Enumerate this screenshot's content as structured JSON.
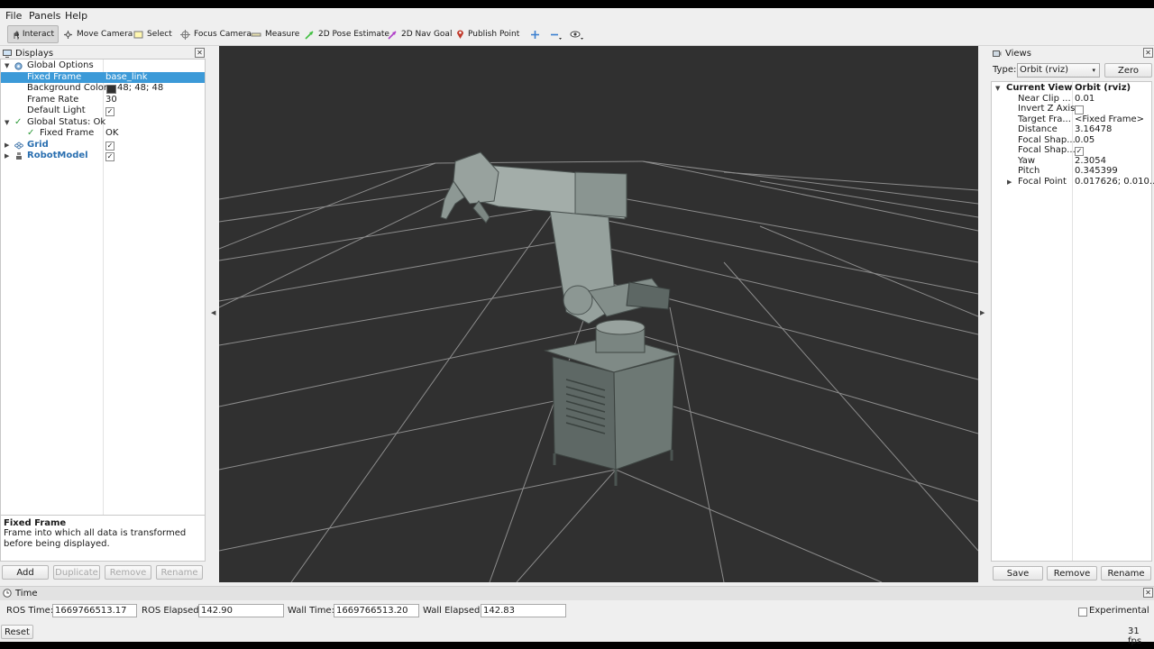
{
  "menu": [
    "File",
    "Panels",
    "Help"
  ],
  "toolbar": {
    "tools": [
      "Interact",
      "Move Camera",
      "Select",
      "Focus Camera",
      "Measure",
      "2D Pose Estimate",
      "2D Nav Goal",
      "Publish Point"
    ]
  },
  "displays": {
    "title": "Displays",
    "rows": [
      {
        "key": "Global Options",
        "value": ""
      },
      {
        "key": "Fixed Frame",
        "value": "base_link"
      },
      {
        "key": "Background Color",
        "value": "48; 48; 48"
      },
      {
        "key": "Frame Rate",
        "value": "30"
      },
      {
        "key": "Default Light",
        "value": "✓"
      },
      {
        "key": "Global Status: Ok",
        "value": ""
      },
      {
        "key": "Fixed Frame",
        "value": "OK"
      },
      {
        "key": "Grid",
        "value": "✓"
      },
      {
        "key": "RobotModel",
        "value": "✓"
      }
    ],
    "help_title": "Fixed Frame",
    "help_text": "Frame into which all data is transformed before being displayed.",
    "buttons": [
      "Add",
      "Duplicate",
      "Remove",
      "Rename"
    ]
  },
  "views": {
    "title": "Views",
    "type_label": "Type:",
    "type_value": "Orbit (rviz)",
    "zero_label": "Zero",
    "current_key": "Current View",
    "current_value": "Orbit (rviz)",
    "rows": [
      {
        "key": "Near Clip ...",
        "value": "0.01"
      },
      {
        "key": "Invert Z Axis",
        "value": ""
      },
      {
        "key": "Target Fra...",
        "value": "<Fixed Frame>"
      },
      {
        "key": "Distance",
        "value": "3.16478"
      },
      {
        "key": "Focal Shap...",
        "value": "0.05"
      },
      {
        "key": "Focal Shap...",
        "value": "✓"
      },
      {
        "key": "Yaw",
        "value": "2.3054"
      },
      {
        "key": "Pitch",
        "value": "0.345399"
      },
      {
        "key": "Focal Point",
        "value": "0.017626; 0.010..."
      }
    ],
    "buttons": [
      "Save",
      "Remove",
      "Rename"
    ]
  },
  "time": {
    "title": "Time",
    "ros_time_label": "ROS Time:",
    "ros_time": "1669766513.17",
    "ros_elapsed_label": "ROS Elapsed:",
    "ros_elapsed": "142.90",
    "wall_time_label": "Wall Time:",
    "wall_time": "1669766513.20",
    "wall_elapsed_label": "Wall Elapsed:",
    "wall_elapsed": "142.83",
    "experimental_label": "Experimental",
    "reset_label": "Reset",
    "fps": "31 fps"
  },
  "colors": {
    "viewport_bg": "#303030",
    "selection": "#3c9ad8",
    "grid_line": "#9a9a9a"
  }
}
